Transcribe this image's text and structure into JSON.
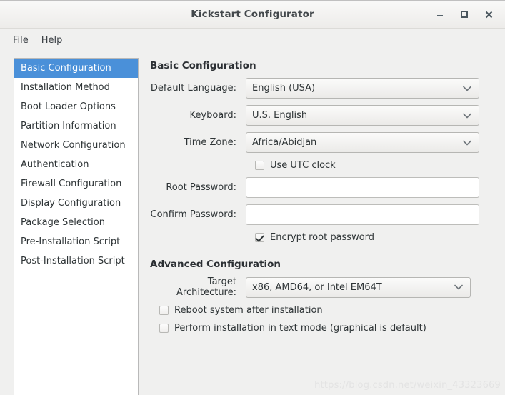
{
  "window": {
    "title": "Kickstart Configurator",
    "controls": {
      "minimize": "minimize-icon",
      "maximize": "maximize-icon",
      "close": "close-icon"
    }
  },
  "menubar": {
    "items": [
      {
        "label": "File"
      },
      {
        "label": "Help"
      }
    ]
  },
  "sidebar": {
    "items": [
      {
        "label": "Basic Configuration",
        "selected": true
      },
      {
        "label": "Installation Method",
        "selected": false
      },
      {
        "label": "Boot Loader Options",
        "selected": false
      },
      {
        "label": "Partition Information",
        "selected": false
      },
      {
        "label": "Network Configuration",
        "selected": false
      },
      {
        "label": "Authentication",
        "selected": false
      },
      {
        "label": "Firewall Configuration",
        "selected": false
      },
      {
        "label": "Display Configuration",
        "selected": false
      },
      {
        "label": "Package Selection",
        "selected": false
      },
      {
        "label": "Pre-Installation Script",
        "selected": false
      },
      {
        "label": "Post-Installation Script",
        "selected": false
      }
    ]
  },
  "main": {
    "basic": {
      "heading": "Basic Configuration",
      "default_language": {
        "label": "Default Language:",
        "value": "English (USA)"
      },
      "keyboard": {
        "label": "Keyboard:",
        "value": "U.S. English"
      },
      "time_zone": {
        "label": "Time Zone:",
        "value": "Africa/Abidjan"
      },
      "use_utc": {
        "label": "Use UTC clock",
        "checked": false
      },
      "root_password": {
        "label": "Root Password:",
        "value": "",
        "placeholder": ""
      },
      "confirm_password": {
        "label": "Confirm Password:",
        "value": "",
        "placeholder": ""
      },
      "encrypt_root_password": {
        "label": "Encrypt root password",
        "checked": true
      }
    },
    "advanced": {
      "heading": "Advanced Configuration",
      "target_architecture": {
        "label": "Target Architecture:",
        "value": "x86, AMD64, or Intel EM64T"
      },
      "reboot_after_install": {
        "label": "Reboot system after installation",
        "checked": false
      },
      "text_mode_install": {
        "label": "Perform installation in text mode (graphical is default)",
        "checked": false
      }
    }
  },
  "watermark": {
    "text": "https://blog.csdn.net/weixin_43323669"
  },
  "colors": {
    "selection_blue": "#4a90d9",
    "window_bg": "#f0f0ef",
    "text": "#2e3436",
    "title_text": "#43484c"
  }
}
